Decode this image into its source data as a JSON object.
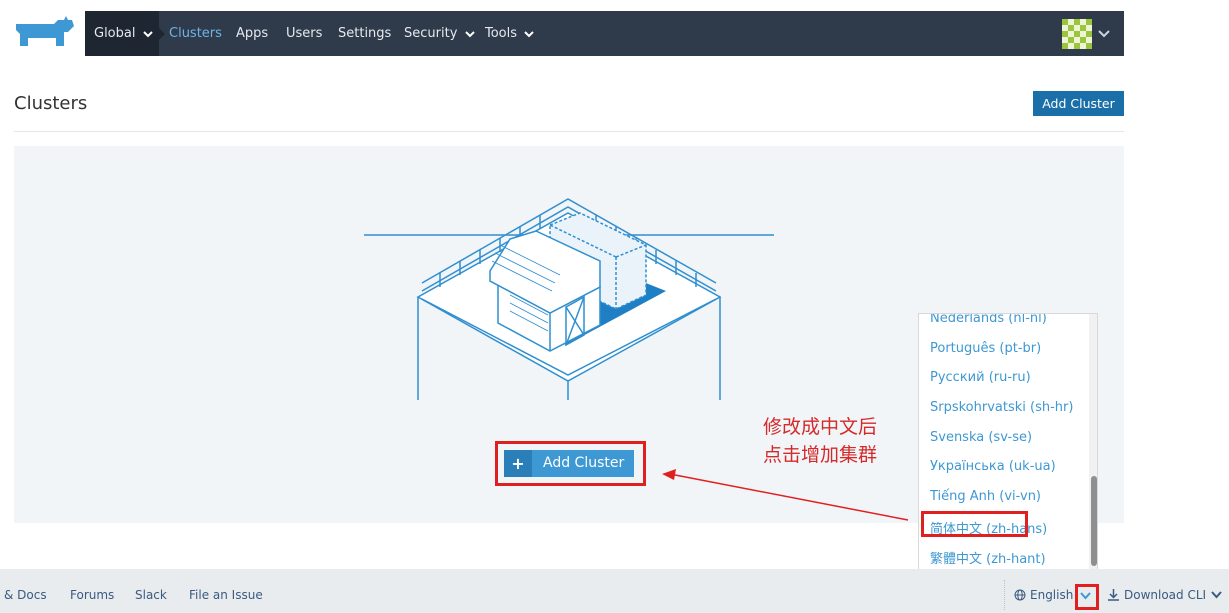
{
  "header": {
    "logo": "rancher-logo",
    "nav": {
      "global": "Global",
      "clusters": "Clusters",
      "apps": "Apps",
      "users": "Users",
      "settings": "Settings",
      "security": "Security",
      "tools": "Tools"
    }
  },
  "page": {
    "title": "Clusters",
    "add_cluster_top": "Add Cluster",
    "empty_state": {
      "add_cluster_label": "Add Cluster",
      "plus_icon": "+"
    }
  },
  "annotation": {
    "line1": "修改成中文后",
    "line2": "点击增加集群",
    "color": "#d42a2a"
  },
  "language_menu": {
    "items": [
      "Nederlands (nl-nl)",
      "Português (pt-br)",
      "Русский (ru-ru)",
      "Srpskohrvatski (sh-hr)",
      "Svenska (sv-se)",
      "Українська (uk-ua)",
      "Tiếng Anh (vi-vn)",
      "简体中文 (zh-hans)",
      "繁體中文 (zh-hant)"
    ],
    "highlighted": "简体中文 (zh-hans)"
  },
  "footer": {
    "docs": "& Docs",
    "forums": "Forums",
    "slack": "Slack",
    "file_issue": "File an Issue",
    "language": "English",
    "download_cli": "Download CLI"
  },
  "colors": {
    "navbar": "#2f3b4a",
    "accent": "#3d98d3",
    "primary_button": "#1b6fa8",
    "highlight": "#e02020"
  }
}
